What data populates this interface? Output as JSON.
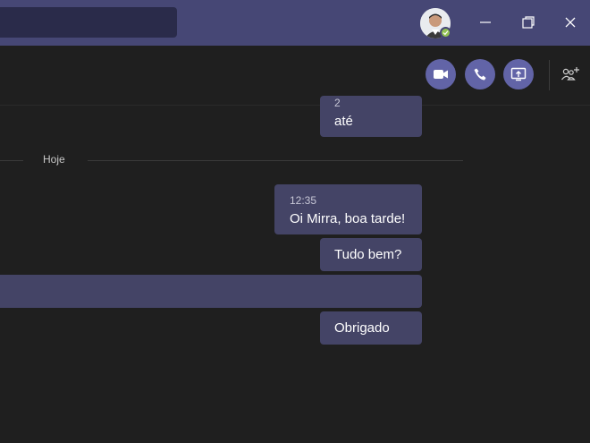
{
  "titlebar": {
    "search_value": "",
    "avatar_name": "user-avatar",
    "presence": "available",
    "colors": {
      "bar": "#464775",
      "presence": "#92c353"
    }
  },
  "header": {
    "actions": [
      "video-call",
      "audio-call",
      "share-screen",
      "add-people"
    ],
    "accent": "#6264a7"
  },
  "chat": {
    "prev_time_partial": "2",
    "day_label": "Hoje",
    "messages": [
      {
        "text": "até"
      },
      {
        "timestamp": "12:35",
        "text": "Oi Mirra, boa tarde!"
      },
      {
        "text": "Tudo bem?"
      },
      {
        "text": ""
      },
      {
        "text": "Obrigado"
      }
    ],
    "bubble_color": "#444466"
  }
}
